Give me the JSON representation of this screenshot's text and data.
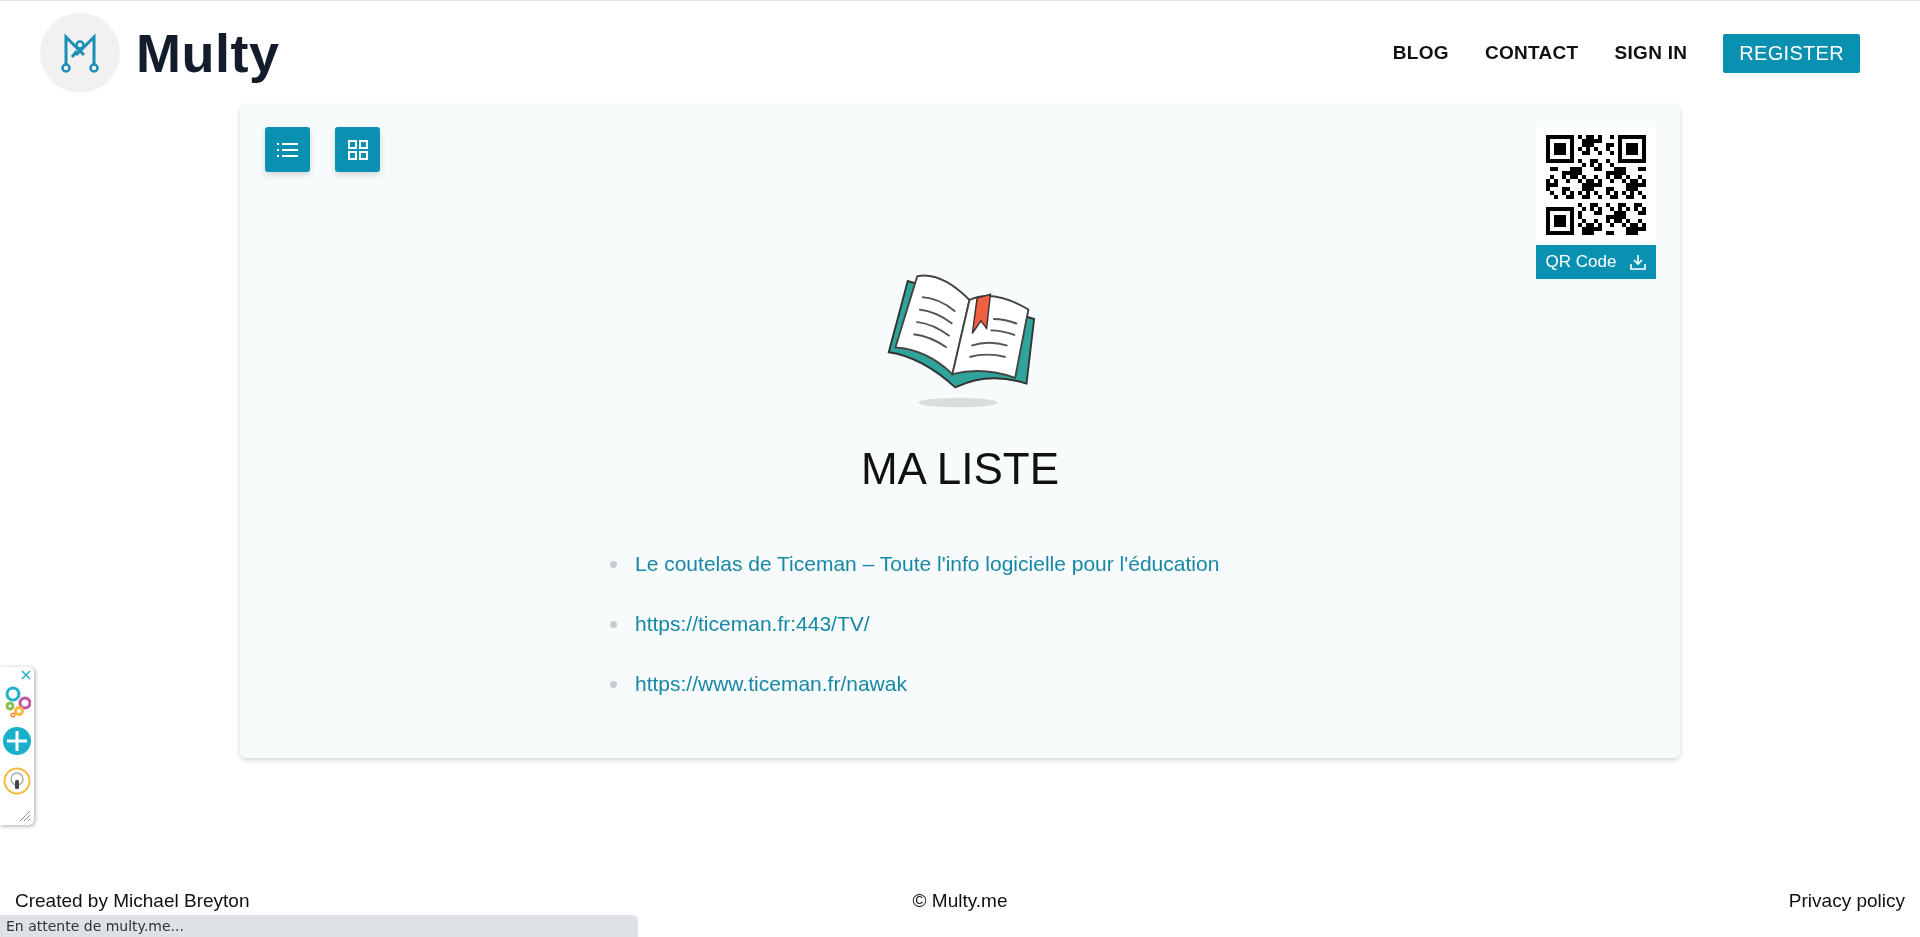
{
  "header": {
    "logo_text": "Multy",
    "nav": [
      {
        "label": "BLOG",
        "kind": "link"
      },
      {
        "label": "CONTACT",
        "kind": "link"
      },
      {
        "label": "SIGN IN",
        "kind": "link"
      },
      {
        "label": "REGISTER",
        "kind": "button"
      }
    ]
  },
  "qr": {
    "label": "QR Code"
  },
  "list": {
    "title": "MA LISTE",
    "items": [
      {
        "text": "Le coutelas de Ticeman – Toute l'info logicielle pour l'éducation"
      },
      {
        "text": "https://ticeman.fr:443/TV/"
      },
      {
        "text": "https://www.ticeman.fr/nawak"
      }
    ]
  },
  "footer": {
    "left": "Created by Michael Breyton",
    "center": "© Multy.me",
    "right": "Privacy policy"
  },
  "status_bar": {
    "text": "En attente de multy.me..."
  }
}
